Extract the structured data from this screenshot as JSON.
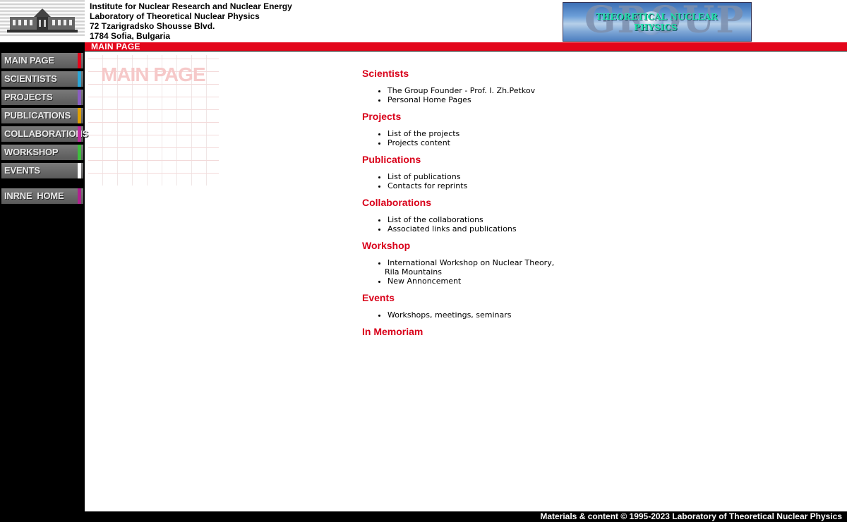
{
  "header": {
    "address_lines": [
      "Institute for Nuclear Research and Nuclear Energy",
      "Laboratory of Theoretical Nuclear Physics",
      "72 Tzarigradsko Shousse Blvd.",
      "1784 Sofia, Bulgaria"
    ],
    "group_logo": {
      "big_text": "GROUP",
      "line1": "THEORETICAL NUCLEAR",
      "line2": "PHYSICS"
    }
  },
  "page_title": "MAIN PAGE",
  "watermark_text": "MAIN PAGE",
  "sidebar": {
    "items": [
      {
        "label": "MAIN PAGE",
        "accent": "#e3061b"
      },
      {
        "label": "SCIENTISTS",
        "accent": "#2aa7d8"
      },
      {
        "label": "PROJECTS",
        "accent": "#8a5cc2"
      },
      {
        "label": "PUBLICATIONS",
        "accent": "#e0a000"
      },
      {
        "label": "COLLABORATIONS",
        "accent": "#c02a9e"
      },
      {
        "label": "WORKSHOP",
        "accent": "#3ebd3e"
      },
      {
        "label": "EVENTS",
        "accent": "#ffffff"
      }
    ],
    "home": {
      "label": "INRNE  HOME",
      "accent": "#b0208e"
    }
  },
  "content": {
    "sections": [
      {
        "title": "Scientists",
        "links": [
          "The Group Founder - Prof. I. Zh.Petkov",
          "Personal Home Pages"
        ]
      },
      {
        "title": "Projects",
        "links": [
          "List of the projects",
          "Projects content"
        ]
      },
      {
        "title": "Publications",
        "links": [
          "List of publications",
          "Contacts for reprints"
        ]
      },
      {
        "title": "Collaborations",
        "links": [
          "List of the collaborations",
          "Associated links and publications"
        ]
      },
      {
        "title": "Workshop",
        "links": [
          "International Workshop on Nuclear Theory,",
          "New Annoncement"
        ],
        "continuation": "Rila Mountains"
      },
      {
        "title": "Events",
        "links": [
          "Workshops, meetings, seminars"
        ]
      },
      {
        "title": "In Memoriam",
        "links": []
      }
    ]
  },
  "footer": "Materials & content © 1995-2023 Laboratory of Theoretical Nuclear Physics",
  "colors": {
    "accent_red": "#e3061b",
    "heading_red": "#d9001a"
  }
}
